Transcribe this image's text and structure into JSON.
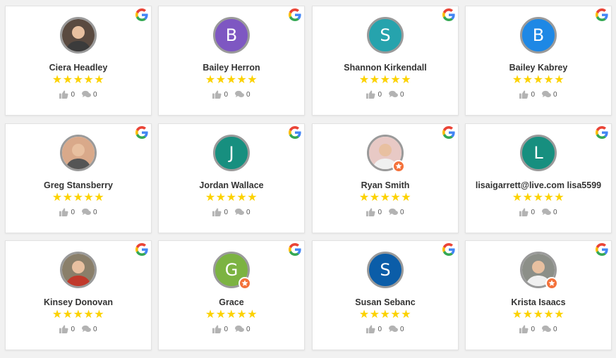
{
  "colors": {
    "star": "#fcd200",
    "avatar_border": "#9a9a9a",
    "local_guide_badge": "#f4713a"
  },
  "icons": {
    "source": "google-icon",
    "like": "thumbs-up-icon",
    "comment": "comment-icon",
    "badge": "local-guide-badge-icon"
  },
  "reviews": [
    {
      "name": "Ciera Headley",
      "initial": "",
      "photo": true,
      "avatar_color": "#5a4a40",
      "rating": 5,
      "stars": "★★★★★",
      "likes": "0",
      "comments": "0",
      "local_guide": false
    },
    {
      "name": "Bailey Herron",
      "initial": "B",
      "photo": false,
      "avatar_color": "#7e57c2",
      "rating": 5,
      "stars": "★★★★★",
      "likes": "0",
      "comments": "0",
      "local_guide": false
    },
    {
      "name": "Shannon Kirkendall",
      "initial": "S",
      "photo": false,
      "avatar_color": "#26a3ad",
      "rating": 5,
      "stars": "★★★★★",
      "likes": "0",
      "comments": "0",
      "local_guide": false
    },
    {
      "name": "Bailey Kabrey",
      "initial": "B",
      "photo": false,
      "avatar_color": "#1e88e5",
      "rating": 5,
      "stars": "★★★★★",
      "likes": "0",
      "comments": "0",
      "local_guide": false
    },
    {
      "name": "Greg Stansberry",
      "initial": "",
      "photo": true,
      "avatar_color": "#d9a98a",
      "rating": 5,
      "stars": "★★★★★",
      "likes": "0",
      "comments": "0",
      "local_guide": false
    },
    {
      "name": "Jordan Wallace",
      "initial": "J",
      "photo": false,
      "avatar_color": "#178f7f",
      "rating": 5,
      "stars": "★★★★★",
      "likes": "0",
      "comments": "0",
      "local_guide": false
    },
    {
      "name": "Ryan Smith",
      "initial": "",
      "photo": true,
      "avatar_color": "#e8c9c5",
      "rating": 5,
      "stars": "★★★★★",
      "likes": "0",
      "comments": "0",
      "local_guide": true
    },
    {
      "name": "lisaigarrett@live.com lisa5599",
      "initial": "L",
      "photo": false,
      "avatar_color": "#178f7f",
      "rating": 5,
      "stars": "★★★★★",
      "likes": "0",
      "comments": "0",
      "local_guide": false
    },
    {
      "name": "Kinsey Donovan",
      "initial": "",
      "photo": true,
      "avatar_color": "#8a7f6a",
      "rating": 5,
      "stars": "★★★★★",
      "likes": "0",
      "comments": "0",
      "local_guide": false
    },
    {
      "name": "Grace",
      "initial": "G",
      "photo": false,
      "avatar_color": "#7cb342",
      "rating": 5,
      "stars": "★★★★★",
      "likes": "0",
      "comments": "0",
      "local_guide": true
    },
    {
      "name": "Susan Sebanc",
      "initial": "S",
      "photo": false,
      "avatar_color": "#0b5da8",
      "rating": 5,
      "stars": "★★★★★",
      "likes": "0",
      "comments": "0",
      "local_guide": false
    },
    {
      "name": "Krista Isaacs",
      "initial": "",
      "photo": true,
      "avatar_color": "#8c8f88",
      "rating": 5,
      "stars": "★★★★★",
      "likes": "0",
      "comments": "0",
      "local_guide": true
    }
  ]
}
